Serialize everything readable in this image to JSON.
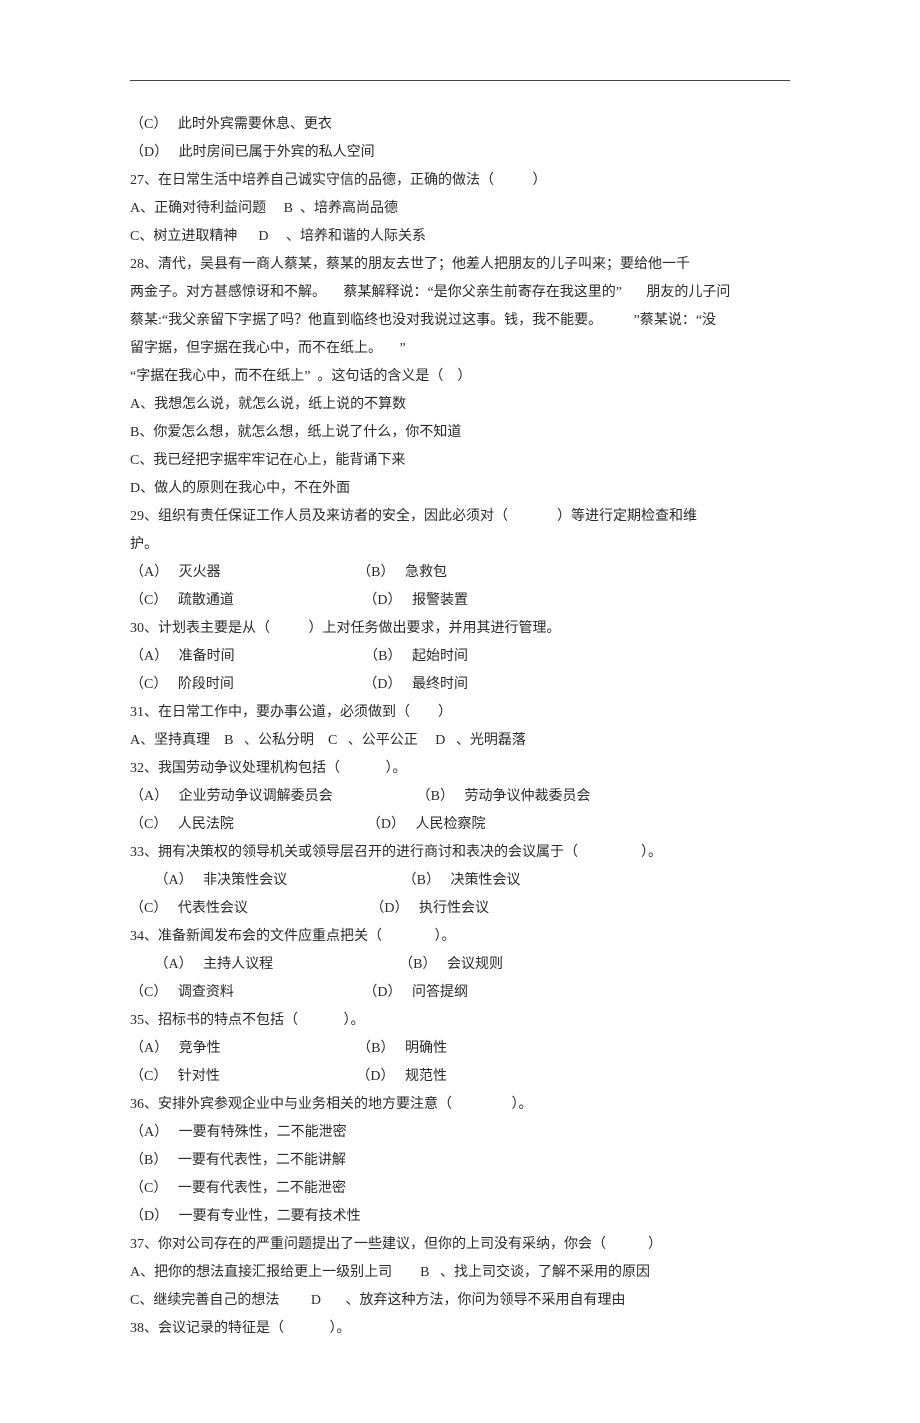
{
  "lines": [
    "（C）   此时外宾需要休息、更衣",
    "（D）   此时房间已属于外宾的私人空间",
    "27、在日常生活中培养自己诚实守信的品德，正确的做法（           ）",
    "A、正确对待利益问题     B  、培养高尚品德",
    "C、树立进取精神      D     、培养和谐的人际关系",
    "28、清代，吴县有一商人蔡某，蔡某的朋友去世了；他差人把朋友的儿子叫来；要给他一千",
    "两金子。对方甚感惊讶和不解。     蔡某解释说：“是你父亲生前寄存在我这里的”       朋友的儿子问",
    "蔡某:“我父亲留下字据了吗？他直到临终也没对我说过这事。钱，我不能要。         ”蔡某说：“没",
    "留字据，但字据在我心中，而不在纸上。     ”",
    "“字据在我心中，而不在纸上”  。这句话的含义是（    ）",
    "A、我想怎么说，就怎么说，纸上说的不算数",
    "B、你爱怎么想，就怎么想，纸上说了什么，你不知道",
    "C、我已经把字据牢牢记在心上，能背诵下来",
    "D、做人的原则在我心中，不在外面",
    "29、组织有责任保证工作人员及来访者的安全，因此必须对（              ）等进行定期检查和维",
    "护。",
    "（A）   灭火器                                       （B）   急救包",
    "（C）   疏散通道                                     （D）   报警装置",
    "30、计划表主要是从（           ）上对任务做出要求，并用其进行管理。",
    "（A）   准备时间                                     （B）   起始时间",
    "（C）   阶段时间                                     （D）   最终时间",
    "31、在日常工作中，要办事公道，必须做到（        ）",
    "A、坚持真理    B   、公私分明    C   、公平公正     D   、光明磊落",
    "32、我国劳动争议处理机构包括（             ）。",
    "（A）   企业劳动争议调解委员会                        （B）   劳动争议仲裁委员会",
    "（C）   人民法院                                      （D）   人民检察院",
    "33、拥有决策权的领导机关或领导层召开的进行商讨和表决的会议属于（                  ）。",
    "       （A）   非决策性会议                                 （B）   决策性会议",
    "（C）   代表性会议                                   （D）   执行性会议",
    "34、准备新闻发布会的文件应重点把关（               ）。",
    "       （A）   主持人议程                                    （B）   会议规则",
    "（C）   调查资料                                     （D）   问答提纲",
    "35、招标书的特点不包括（             ）。",
    "（A）   竞争性                                       （B）   明确性",
    "（C）   针对性                                       （D）   规范性",
    "36、安排外宾参观企业中与业务相关的地方要注意（                 ）。",
    "（A）   一要有特殊性，二不能泄密",
    "（B）   一要有代表性，二不能讲解",
    "（C）   一要有代表性，二不能泄密",
    "（D）   一要有专业性，二要有技术性",
    "37、你对公司存在的严重问题提出了一些建议，但你的上司没有采纳，你会（            ）",
    "A、把你的想法直接汇报给更上一级别上司        B   、找上司交谈，了解不采用的原因",
    "C、继续完善自己的想法         D       、放弃这种方法，你问为领导不采用自有理由",
    "38、会议记录的特征是（             ）。"
  ]
}
